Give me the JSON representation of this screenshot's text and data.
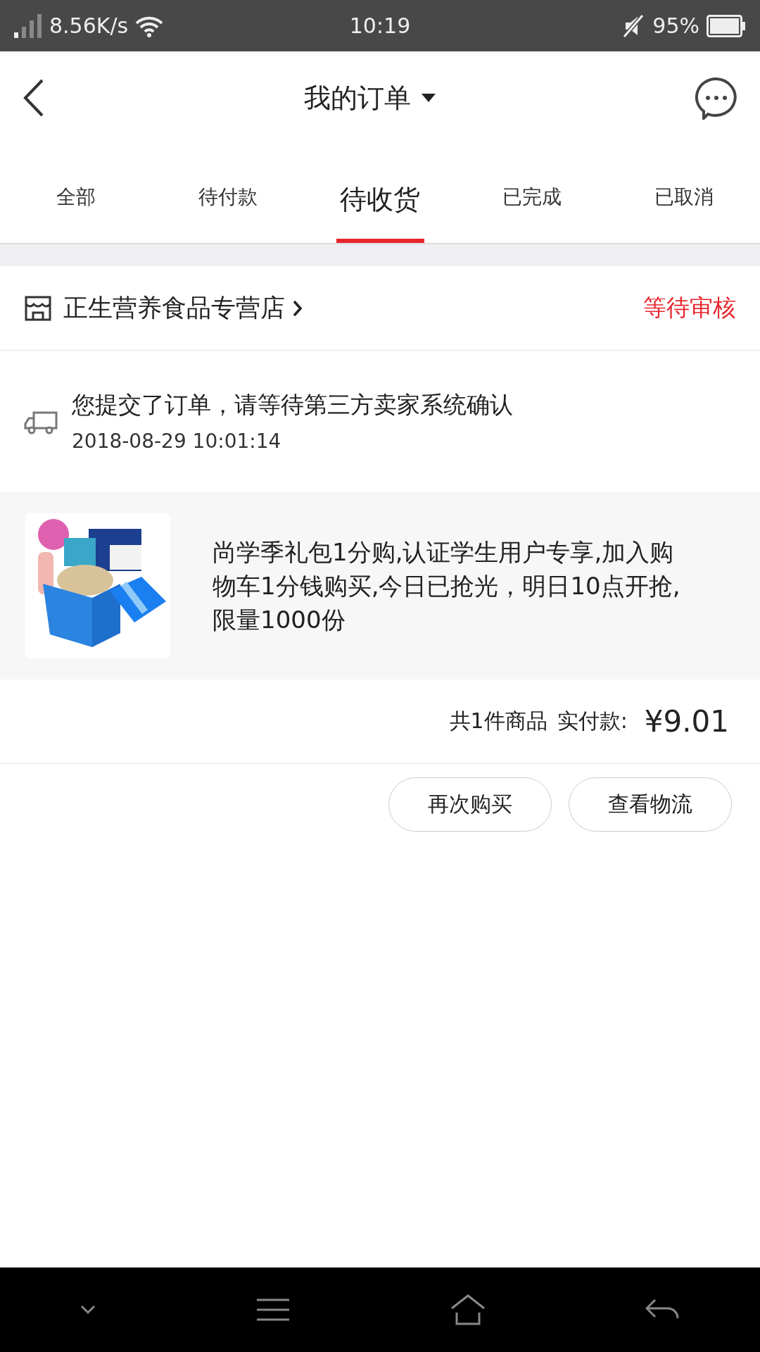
{
  "status_bar": {
    "net_speed": "8.56K/s",
    "time": "10:19",
    "battery": "95%"
  },
  "header": {
    "title": "我的订单"
  },
  "tabs": [
    {
      "label": "全部",
      "selected": false
    },
    {
      "label": "待付款",
      "selected": false
    },
    {
      "label": "待收货",
      "selected": true
    },
    {
      "label": "已完成",
      "selected": false
    },
    {
      "label": "已取消",
      "selected": false
    }
  ],
  "order": {
    "shop": "正生营养食品专营店",
    "status": "等待审核",
    "tracking_message": "您提交了订单，请等待第三方卖家系统确认",
    "tracking_time": "2018-08-29 10:01:14",
    "product": {
      "title": "尚学季礼包1分购,认证学生用户专享,加入购物车1分钱购买,今日已抢光，明日10点开抢,限量1000份"
    },
    "summary": "共1件商品",
    "paid_label": "实付款:",
    "paid_amount": "¥9.01",
    "actions": [
      "再次购买",
      "查看物流"
    ]
  }
}
